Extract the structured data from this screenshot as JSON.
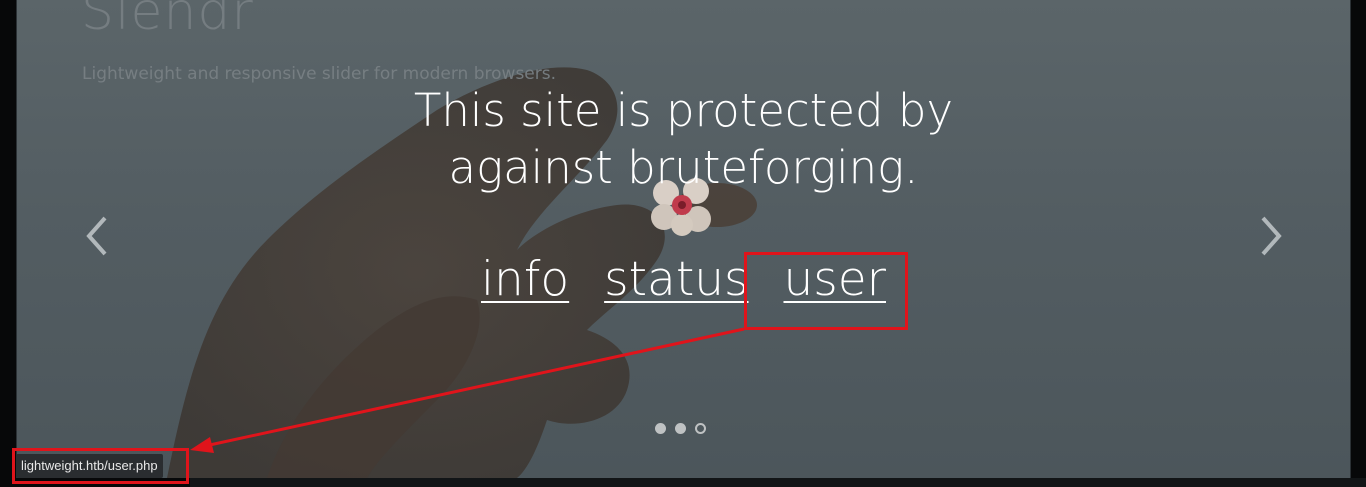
{
  "brand": {
    "title": "Slendr",
    "tagline": "Lightweight and responsive slider for modern browsers."
  },
  "headline": {
    "line1": "This site is protected by",
    "line2": "against bruteforging."
  },
  "nav_links": [
    {
      "label": "info"
    },
    {
      "label": "status"
    },
    {
      "label": "user"
    }
  ],
  "slider": {
    "prev_icon": "chevron-left-icon",
    "next_icon": "chevron-right-icon",
    "dots": 3,
    "active_dot_style": "hollow"
  },
  "status_bar": {
    "url": "lightweight.htb/user.php"
  },
  "annotation": {
    "color": "#e0141b"
  }
}
